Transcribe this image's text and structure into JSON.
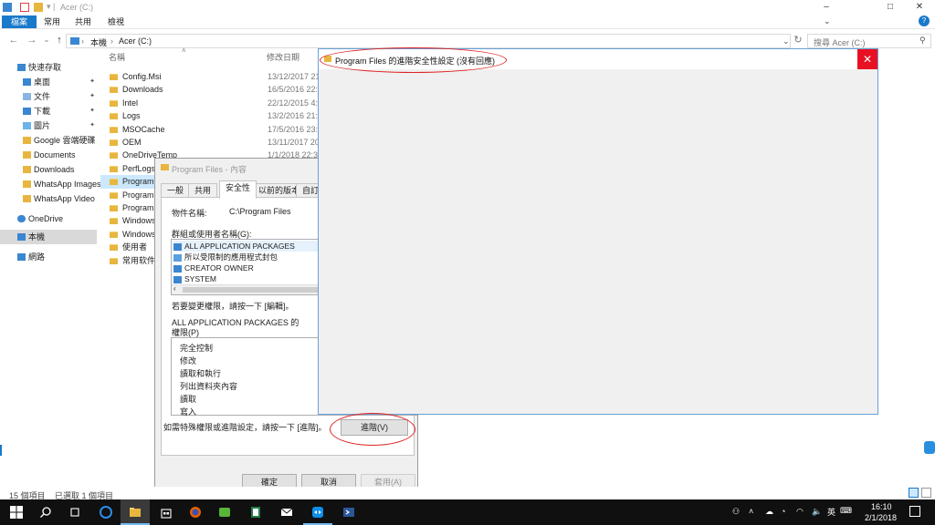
{
  "explorer": {
    "title": "Acer (C:)",
    "ribbon_tabs": [
      "檔案",
      "常用",
      "共用",
      "檢視"
    ],
    "address": {
      "root": "本機",
      "current": "Acer (C:)"
    },
    "search_placeholder": "搜尋 Acer (C:)",
    "columns": {
      "name": "名稱",
      "date": "修改日期"
    }
  },
  "nav": {
    "items": [
      {
        "label": "快速存取"
      },
      {
        "label": "桌面",
        "pinned": true
      },
      {
        "label": "文件",
        "pinned": true
      },
      {
        "label": "下載",
        "pinned": true
      },
      {
        "label": "圖片",
        "pinned": true
      },
      {
        "label": "Google 雲端硬碟",
        "pinned": true
      },
      {
        "label": "Documents"
      },
      {
        "label": "Downloads"
      },
      {
        "label": "WhatsApp Images"
      },
      {
        "label": "WhatsApp Video"
      },
      {
        "label": "OneDrive"
      },
      {
        "label": "本機"
      },
      {
        "label": "網路"
      }
    ]
  },
  "files": [
    {
      "name": "Config.Msi",
      "date": "13/12/2017 21"
    },
    {
      "name": "Downloads",
      "date": "16/5/2016 22:"
    },
    {
      "name": "Intel",
      "date": "22/12/2015 4:2"
    },
    {
      "name": "Logs",
      "date": "13/2/2016 21:2"
    },
    {
      "name": "MSOCache",
      "date": "17/5/2016 23:"
    },
    {
      "name": "OEM",
      "date": "13/11/2017 20"
    },
    {
      "name": "OneDriveTemp",
      "date": "1/1/2018 22:30"
    },
    {
      "name": "PerfLogs",
      "date": ""
    },
    {
      "name": "Program",
      "date": ""
    },
    {
      "name": "Program",
      "date": ""
    },
    {
      "name": "ProgramD",
      "date": ""
    },
    {
      "name": "Windows",
      "date": ""
    },
    {
      "name": "Windows",
      "date": ""
    },
    {
      "name": "使用者",
      "date": ""
    },
    {
      "name": "常用软件",
      "date": ""
    }
  ],
  "status": {
    "count": "15 個項目",
    "selected": "已選取 1 個項目"
  },
  "props": {
    "title": "Program Files - 內容",
    "tabs": [
      "一般",
      "共用",
      "安全性",
      "以前的版本",
      "自訂"
    ],
    "object_label": "物件名稱:",
    "object_value": "C:\\Program Files",
    "groups_label": "群組或使用者名稱(G):",
    "groups": [
      "ALL APPLICATION PACKAGES",
      "所以受限制的應用程式封包",
      "CREATOR OWNER",
      "SYSTEM"
    ],
    "change_hint": "若要變更權限，請按一下 [編輯]。",
    "perm_label_1": "ALL APPLICATION PACKAGES 的",
    "perm_label_2": "權限(P)",
    "permissions": [
      "完全控制",
      "修改",
      "讀取和執行",
      "列出資料夾內容",
      "讀取",
      "寫入"
    ],
    "advanced_hint": "如需特殊權限或進階設定，請按一下 [進階]。",
    "advanced_button": "進階(V)",
    "ok": "確定",
    "cancel": "取消",
    "apply": "套用(A)"
  },
  "advanced_window": {
    "title": "Program Files 的進階安全性設定 (沒有回應)"
  },
  "tray": {
    "ime": "英",
    "time": "16:10",
    "date": "2/1/2018"
  },
  "colors": {
    "accent": "#1979ca",
    "close_red": "#e81123",
    "folder": "#e8b640",
    "annotation": "#dd2222"
  }
}
